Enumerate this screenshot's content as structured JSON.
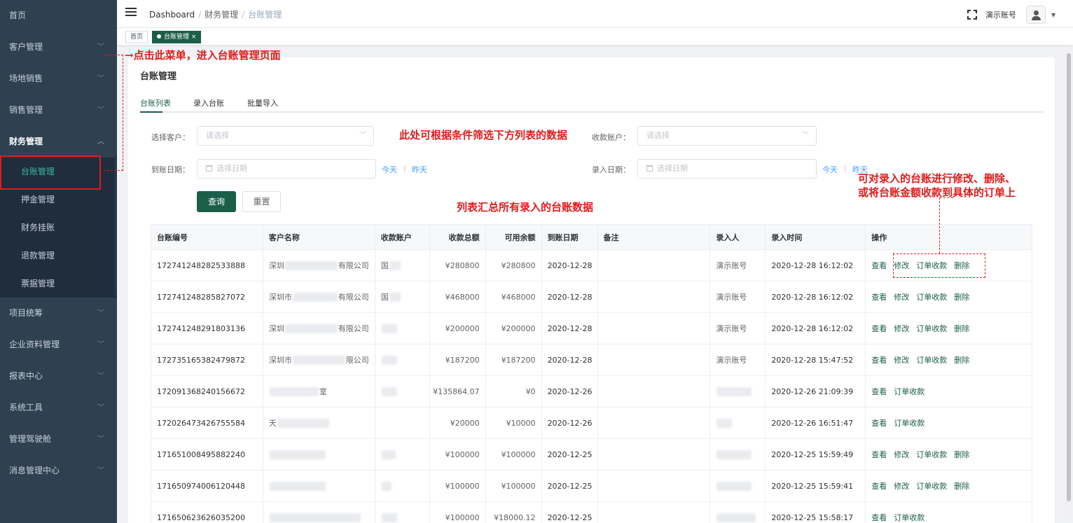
{
  "sidebar": {
    "items": [
      {
        "label": "首页",
        "has_children": false
      },
      {
        "label": "客户管理",
        "has_children": true
      },
      {
        "label": "场地销售",
        "has_children": true
      },
      {
        "label": "销售管理",
        "has_children": true
      },
      {
        "label": "财务管理",
        "has_children": true,
        "expanded": true
      }
    ],
    "finance_sub": [
      "台账管理",
      "押金管理",
      "财务挂账",
      "退款管理",
      "票据管理"
    ],
    "items_after": [
      "项目统筹",
      "企业资料管理",
      "报表中心",
      "系统工具",
      "管理驾驶舱",
      "消息管理中心"
    ]
  },
  "header": {
    "breadcrumb": [
      "Dashboard",
      "财务管理",
      "台账管理"
    ],
    "breadcrumb_sep": "/",
    "user": "演示账号"
  },
  "tagsview": {
    "home": "首页",
    "active": "台账管理",
    "close": "×"
  },
  "page": {
    "title": "台账管理",
    "tabs": [
      "台账列表",
      "录入台账",
      "批量导入"
    ]
  },
  "filters": {
    "customer_label": "选择客户：",
    "customer_placeholder": "请选择",
    "account_label": "收款账户：",
    "account_placeholder": "请选择",
    "arrive_label": "到账日期：",
    "arrive_placeholder": "选择日期",
    "entry_label": "录入日期：",
    "entry_placeholder": "选择日期",
    "today": "今天",
    "yesterday": "昨天",
    "query": "查询",
    "reset": "重置"
  },
  "table": {
    "columns": [
      "台账编号",
      "客户名称",
      "收款账户",
      "收款总额",
      "可用余额",
      "到账日期",
      "备注",
      "录入人",
      "录入时间",
      "操作"
    ],
    "rows": [
      {
        "id": "172741248282533888",
        "customer": "深圳",
        "customer_tail": "有限公司",
        "account": "国",
        "total": "¥280800",
        "balance": "¥280800",
        "date": "2020-12-28",
        "note": "",
        "operator": "演示账号",
        "time": "2020-12-28 16:12:02",
        "ops": [
          "查看",
          "修改",
          "订单收款",
          "删除"
        ]
      },
      {
        "id": "172741248285827072",
        "customer": "深圳市",
        "customer_tail": "有限公司",
        "account": "国",
        "total": "¥468000",
        "balance": "¥468000",
        "date": "2020-12-28",
        "note": "",
        "operator": "演示账号",
        "time": "2020-12-28 16:12:02",
        "ops": [
          "查看",
          "修改",
          "订单收款",
          "删除"
        ]
      },
      {
        "id": "172741248291803136",
        "customer": "深圳",
        "customer_tail": "有限公司",
        "account": "",
        "total": "¥200000",
        "balance": "¥200000",
        "date": "2020-12-28",
        "note": "",
        "operator": "演示账号",
        "time": "2020-12-28 16:12:02",
        "ops": [
          "查看",
          "修改",
          "订单收款",
          "删除"
        ]
      },
      {
        "id": "172735165382479872",
        "customer": "深圳市",
        "customer_tail": "限公司",
        "account": "",
        "total": "¥187200",
        "balance": "¥187200",
        "date": "2020-12-28",
        "note": "",
        "operator": "演示账号",
        "time": "2020-12-28 15:47:52",
        "ops": [
          "查看",
          "修改",
          "订单收款",
          "删除"
        ]
      },
      {
        "id": "172091368240156672",
        "customer": "",
        "customer_tail": "室",
        "account": "",
        "total": "¥135864.07",
        "balance": "¥0",
        "date": "2020-12-26",
        "note": "",
        "operator": "",
        "time": "2020-12-26 21:09:39",
        "ops": [
          "查看",
          "订单收款"
        ]
      },
      {
        "id": "172026473426755584",
        "customer": "天",
        "customer_tail": "",
        "account": "",
        "total": "¥20000",
        "balance": "¥10000",
        "date": "2020-12-26",
        "note": "",
        "operator": "",
        "time": "2020-12-26 16:51:47",
        "ops": [
          "查看",
          "订单收款"
        ]
      },
      {
        "id": "171651008495882240",
        "customer": "",
        "customer_tail": "",
        "account": "",
        "total": "¥100000",
        "balance": "¥100000",
        "date": "2020-12-25",
        "note": "",
        "operator": "",
        "time": "2020-12-25 15:59:49",
        "ops": [
          "查看",
          "修改",
          "订单收款",
          "删除"
        ]
      },
      {
        "id": "171650974006120448",
        "customer": "",
        "customer_tail": "",
        "account": "",
        "total": "¥100000",
        "balance": "¥100000",
        "date": "2020-12-25",
        "note": "",
        "operator": "",
        "time": "2020-12-25 15:59:41",
        "ops": [
          "查看",
          "修改",
          "订单收款",
          "删除"
        ]
      },
      {
        "id": "171650623626035200",
        "customer": "",
        "customer_tail": "",
        "account": "",
        "total": "¥100000",
        "balance": "¥18000.12",
        "date": "2020-12-25",
        "note": "",
        "operator": "",
        "time": "2020-12-25 15:58:17",
        "ops": [
          "查看",
          "订单收款"
        ]
      }
    ]
  },
  "annotations": {
    "menu_hint": "点击此菜单，进入台账管理页面",
    "filter_hint": "此处可根据条件筛选下方列表的数据",
    "list_hint": "列表汇总所有录入的台账数据",
    "ops_hint_1": "可对录入的台账进行修改、删除、",
    "ops_hint_2": "或将台账金额收款到具体的订单上",
    "color": "#e01b1b"
  },
  "colors": {
    "primary": "#1b5e49",
    "sidebar": "#2f4050",
    "link": "#409eff"
  }
}
